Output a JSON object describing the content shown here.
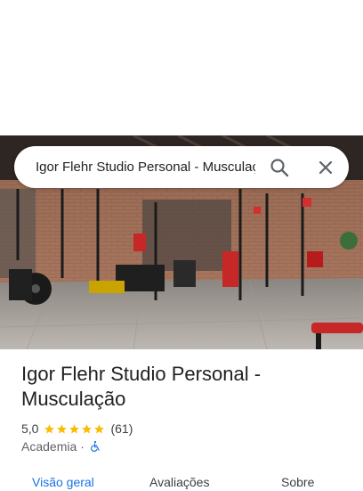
{
  "search": {
    "query": "Igor Flehr Studio Personal - Musculação",
    "search_icon": "search-icon",
    "close_icon": "close-icon"
  },
  "photo": {
    "description_icon": "gym-photo"
  },
  "place": {
    "title": "Igor Flehr Studio Personal - Musculação",
    "rating": "5,0",
    "stars": 5,
    "review_count": "(61)",
    "category": "Academia",
    "separator": "·",
    "accessibility_icon": "wheelchair-icon"
  },
  "tabs": [
    {
      "label": "Visão geral",
      "active": true
    },
    {
      "label": "Avaliações",
      "active": false
    },
    {
      "label": "Sobre",
      "active": false
    }
  ],
  "colors": {
    "accent": "#1a73e8",
    "star": "#fbbc04"
  }
}
